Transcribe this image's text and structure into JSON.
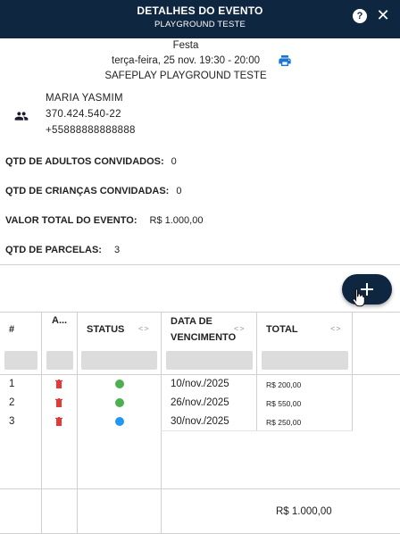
{
  "header": {
    "title": "DETALHES DO EVENTO",
    "subtitle": "PLAYGROUND TESTE",
    "help_glyph": "?",
    "close_glyph": "✕"
  },
  "event": {
    "type": "Festa",
    "datetime": "terça-feira, 25 nov. 19:30 - 20:00",
    "venue": "SAFEPLAY PLAYGROUND TESTE"
  },
  "client": {
    "name": "MARIA YASMIM",
    "document": "370.424.540-22",
    "phone": "+55888888888888"
  },
  "summary": [
    {
      "label": "QTD DE ADULTOS CONVIDADOS:",
      "value": "0"
    },
    {
      "label": "QTD DE CRIANÇAS CONVIDADAS:",
      "value": "0"
    },
    {
      "label": "VALOR TOTAL DO EVENTO:",
      "value": "R$ 1.000,00"
    },
    {
      "label": "QTD DE PARCELAS:",
      "value": "3"
    }
  ],
  "table": {
    "columns": {
      "num": "#",
      "actions": "A...",
      "status": "STATUS",
      "due_line1": "DATA DE",
      "due_line2": "VENCIMENTO",
      "total": "TOTAL"
    },
    "sort_glyph": "<>",
    "rows": [
      {
        "num": "1",
        "status": "paid",
        "due": "10/nov./2025",
        "total": "R$ 200,00"
      },
      {
        "num": "2",
        "status": "paid",
        "due": "26/nov./2025",
        "total": "R$ 550,00"
      },
      {
        "num": "3",
        "status": "pending",
        "due": "30/nov./2025",
        "total": "R$ 250,00"
      }
    ],
    "footer_total": "R$ 1.000,00"
  },
  "colors": {
    "header_bg": "#0f2640",
    "status_paid": "#4caf50",
    "status_pending": "#2196f3",
    "trash": "#e53935",
    "print": "#1976d2"
  }
}
